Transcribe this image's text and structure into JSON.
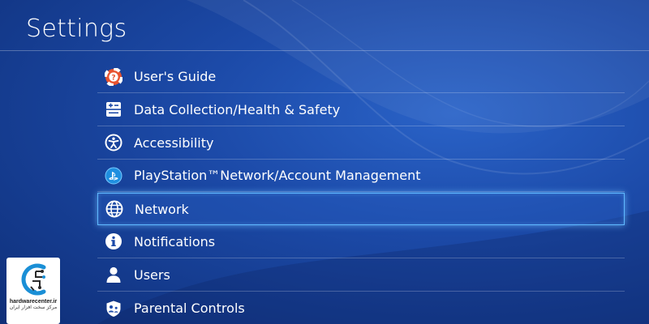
{
  "header": {
    "title": "Settings"
  },
  "menu": {
    "items": [
      {
        "label": "User's Guide",
        "icon": "lifebuoy-question-icon"
      },
      {
        "label": "Data Collection/Health & Safety",
        "icon": "health-safety-icon"
      },
      {
        "label": "Accessibility",
        "icon": "accessibility-icon"
      },
      {
        "label": "PlayStation™Network/Account Management",
        "icon": "playstation-network-icon"
      },
      {
        "label": "Network",
        "icon": "globe-icon",
        "selected": true
      },
      {
        "label": "Notifications",
        "icon": "info-icon"
      },
      {
        "label": "Users",
        "icon": "user-icon"
      },
      {
        "label": "Parental Controls",
        "icon": "parental-controls-icon"
      }
    ]
  },
  "watermark": {
    "site": "hardwarecenter.ir",
    "subtitle": "مرکز سخت افزار ایران"
  },
  "colors": {
    "background": "#1c4aa8",
    "selection_border": "#5fb8ff",
    "text": "#ffffff"
  }
}
